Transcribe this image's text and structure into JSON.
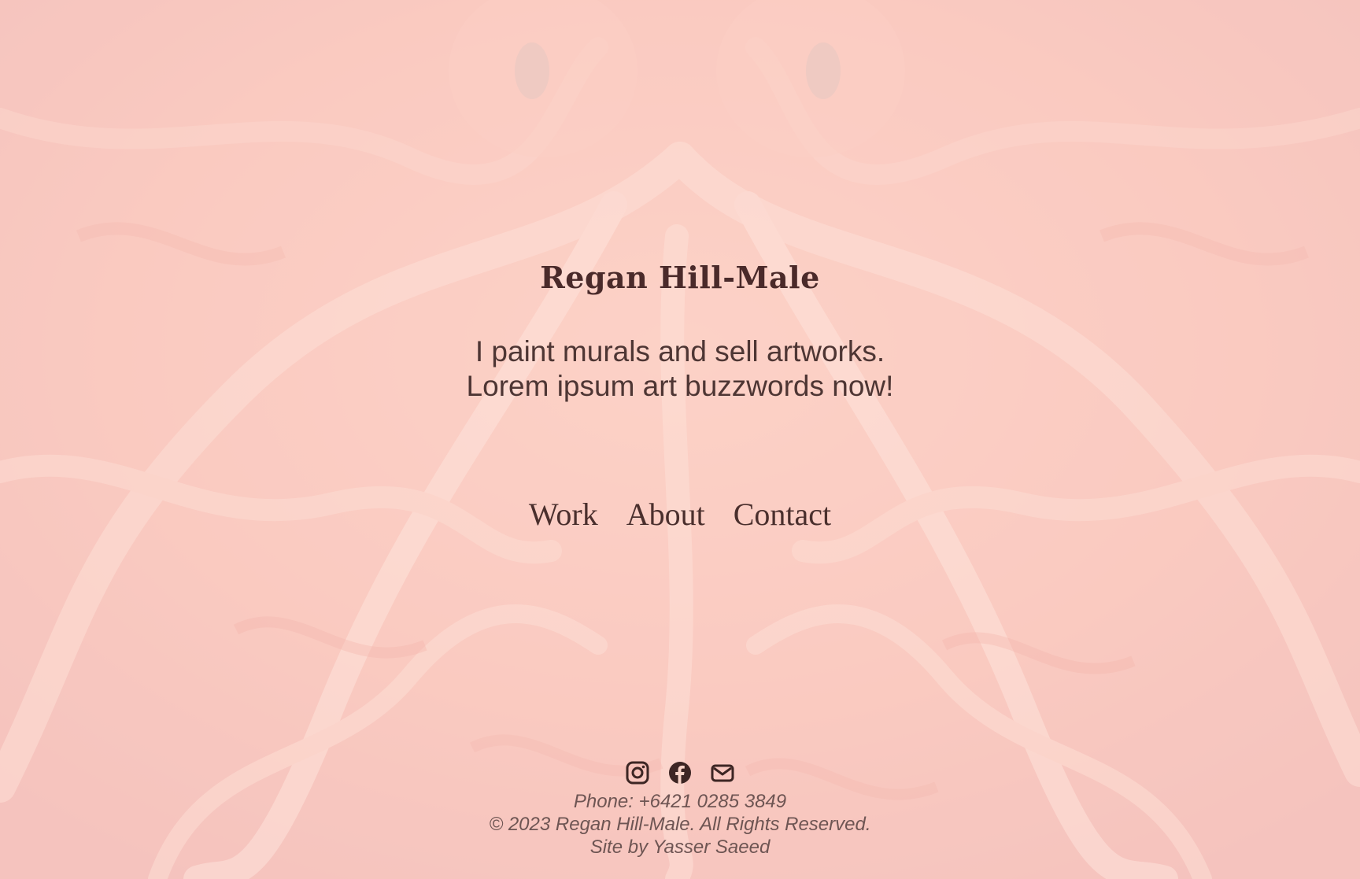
{
  "hero": {
    "name": "Regan Hill-Male",
    "tagline_line1": "I paint murals and sell artworks.",
    "tagline_line2": "Lorem ipsum art buzzwords now!"
  },
  "nav": {
    "items": [
      {
        "label": "Work"
      },
      {
        "label": "About"
      },
      {
        "label": "Contact"
      }
    ]
  },
  "socials": {
    "icons": [
      "instagram-icon",
      "facebook-icon",
      "mail-icon"
    ]
  },
  "footer": {
    "phone": "Phone: +6421 0285 3849",
    "copyright": "© 2023 Regan Hill-Male. All Rights Reserved.",
    "credit": "Site by Yasser Saeed"
  },
  "colors": {
    "background": "#f6c6bd",
    "text": "#4a2f2d",
    "footer_text": "#6e5553"
  }
}
